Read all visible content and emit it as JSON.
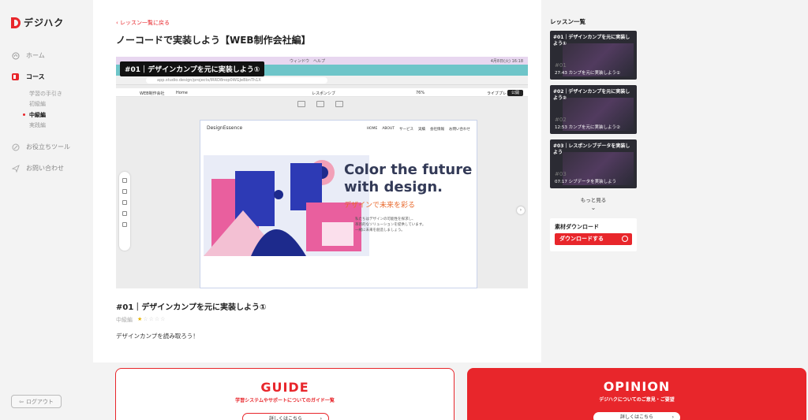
{
  "brand": {
    "logo_text": "デジハク",
    "accent": "#e8262b"
  },
  "sidebar": {
    "nav": [
      {
        "label": "ホーム",
        "icon": "home-icon"
      },
      {
        "label": "コース",
        "icon": "course-icon"
      },
      {
        "label": "お役立ちツール",
        "icon": "tools-icon"
      },
      {
        "label": "お問い合わせ",
        "icon": "send-icon"
      }
    ],
    "sub_items": [
      "学習の手引き",
      "初級編",
      "中級編",
      "実践編"
    ],
    "logout": "ログアウト"
  },
  "main": {
    "back_link": "レッスン一覧に戻る",
    "title": "ノーコードで実装しよう【WEB制作会社編】",
    "lesson_title": "#01｜デザインカンプを元に実装しよう①",
    "level": "中級編",
    "rating": 1,
    "rating_max": 5,
    "description": "デザインカンプを読み取ろう！"
  },
  "video": {
    "caption": "#01｜デザインカンプを元に実装しよう①",
    "menubar_text": "ウィンドウ　ヘルプ",
    "clock": "4月8日(火) 16:18",
    "url": "app.studio.design/projects/lRRD8nop0WGJeBbnTh1X",
    "toolbar_site": "WEB制作会社",
    "toolbar_page": "Home",
    "toolbar_responsive": "レスポンシブ",
    "toolbar_zoom": "76%",
    "toolbar_preview": "ライブプレビュー",
    "toolbar_publish": "公開",
    "site_logo": "DesignEssence",
    "site_nav": [
      "HOME",
      "ABOUT",
      "サービス",
      "実績",
      "会社情報",
      "お問い合わせ"
    ],
    "hero_en": "Color the future with design.",
    "hero_ja": "デザインで未来を彩る",
    "hero_body": "私たちはデザインの可能性を探求し、\n革新的なソリューションを提供しています。\n一緒に未来を創造しましょう。"
  },
  "right_panel": {
    "title": "レッスン一覧",
    "lessons": [
      {
        "title": "#01｜デザインカンプを元に実装しよう①",
        "number": "#01",
        "duration": "27:43",
        "caption": "カンプを元に実装しよう①"
      },
      {
        "title": "#02｜デザインカンプを元に実装しよう②",
        "number": "#02",
        "duration": "12:53",
        "caption": "カンプを元に実装しよう②"
      },
      {
        "title": "#03｜レスポンシブデータを実装しよう",
        "number": "#03",
        "duration": "07:17",
        "caption": "シブデータを実装しよう"
      }
    ],
    "more": "もっと見る",
    "materials_title": "素材ダウンロード",
    "download_button": "ダウンロードする"
  },
  "cards": {
    "guide": {
      "heading": "GUIDE",
      "subtitle": "学習システムやサポートについてのガイド一覧",
      "button": "詳しくはこちら"
    },
    "opinion": {
      "heading": "OPINION",
      "subtitle": "デジハクについてのご意見・ご要望",
      "button": "詳しくはこちら"
    }
  }
}
